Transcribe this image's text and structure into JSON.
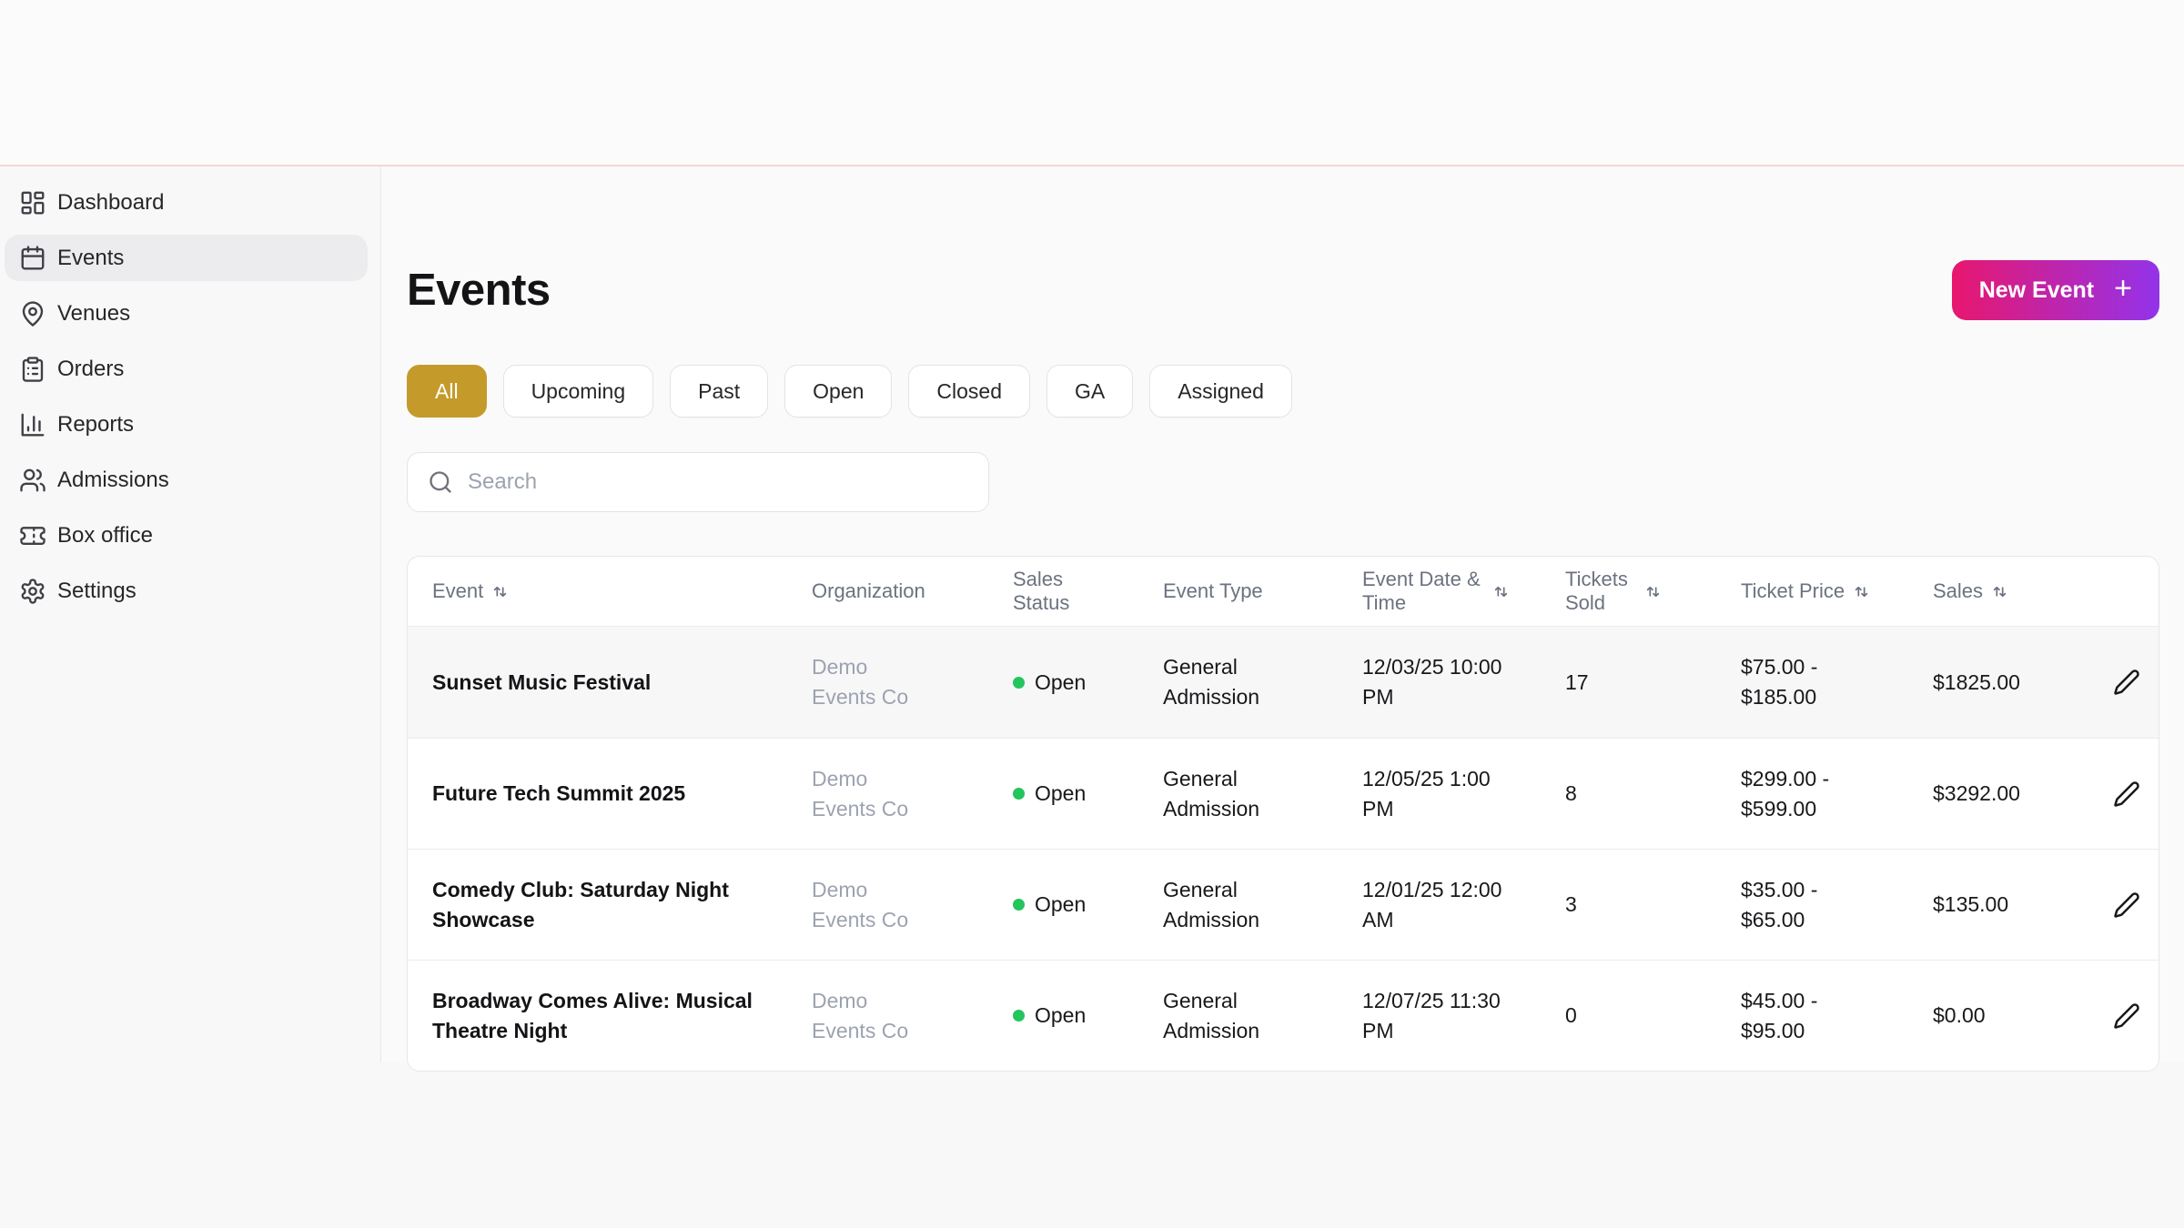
{
  "colors": {
    "accent_gold": "#c49a2a",
    "button_gradient_start": "#e8176e",
    "button_gradient_end": "#9333ea",
    "status_open_green": "#22c55e",
    "top_divider_pink": "#f3d7d3"
  },
  "sidebar": {
    "items": [
      {
        "label": "Dashboard",
        "icon": "dashboard-grid-icon",
        "active": false
      },
      {
        "label": "Events",
        "icon": "calendar-icon",
        "active": true
      },
      {
        "label": "Venues",
        "icon": "map-pin-icon",
        "active": false
      },
      {
        "label": "Orders",
        "icon": "clipboard-icon",
        "active": false
      },
      {
        "label": "Reports",
        "icon": "bar-chart-icon",
        "active": false
      },
      {
        "label": "Admissions",
        "icon": "users-icon",
        "active": false
      },
      {
        "label": "Box office",
        "icon": "ticket-icon",
        "active": false
      },
      {
        "label": "Settings",
        "icon": "gear-icon",
        "active": false
      }
    ]
  },
  "header": {
    "title": "Events",
    "new_event_button": {
      "label": "New Event",
      "plus": "+"
    }
  },
  "filters": [
    {
      "label": "All",
      "active": true
    },
    {
      "label": "Upcoming",
      "active": false
    },
    {
      "label": "Past",
      "active": false
    },
    {
      "label": "Open",
      "active": false
    },
    {
      "label": "Closed",
      "active": false
    },
    {
      "label": "GA",
      "active": false
    },
    {
      "label": "Assigned",
      "active": false
    }
  ],
  "search": {
    "placeholder": "Search"
  },
  "table": {
    "columns": [
      {
        "label": "Event",
        "sortable": true
      },
      {
        "label": "Organization",
        "sortable": false
      },
      {
        "label": "Sales Status",
        "sortable": false
      },
      {
        "label": "Event Type",
        "sortable": false
      },
      {
        "label": "Event Date & Time",
        "sortable": true
      },
      {
        "label": "Tickets Sold",
        "sortable": true
      },
      {
        "label": "Ticket Price",
        "sortable": true
      },
      {
        "label": "Sales",
        "sortable": true
      }
    ],
    "rows": [
      {
        "event": "Sunset Music Festival",
        "organization": "Demo Events Co",
        "sales_status": "Open",
        "event_type": "General Admission",
        "event_datetime": "12/03/25 10:00 PM",
        "tickets_sold": "17",
        "ticket_price": "$75.00 - $185.00",
        "sales": "$1825.00",
        "highlighted": true
      },
      {
        "event": "Future Tech Summit 2025",
        "organization": "Demo Events Co",
        "sales_status": "Open",
        "event_type": "General Admission",
        "event_datetime": "12/05/25 1:00 PM",
        "tickets_sold": "8",
        "ticket_price": "$299.00 - $599.00",
        "sales": "$3292.00",
        "highlighted": false
      },
      {
        "event": "Comedy Club: Saturday Night Showcase",
        "organization": "Demo Events Co",
        "sales_status": "Open",
        "event_type": "General Admission",
        "event_datetime": "12/01/25 12:00 AM",
        "tickets_sold": "3",
        "ticket_price": "$35.00 - $65.00",
        "sales": "$135.00",
        "highlighted": false
      },
      {
        "event": "Broadway Comes Alive: Musical Theatre Night",
        "organization": "Demo Events Co",
        "sales_status": "Open",
        "event_type": "General Admission",
        "event_datetime": "12/07/25 11:30 PM",
        "tickets_sold": "0",
        "ticket_price": "$45.00 - $95.00",
        "sales": "$0.00",
        "highlighted": false
      }
    ]
  }
}
